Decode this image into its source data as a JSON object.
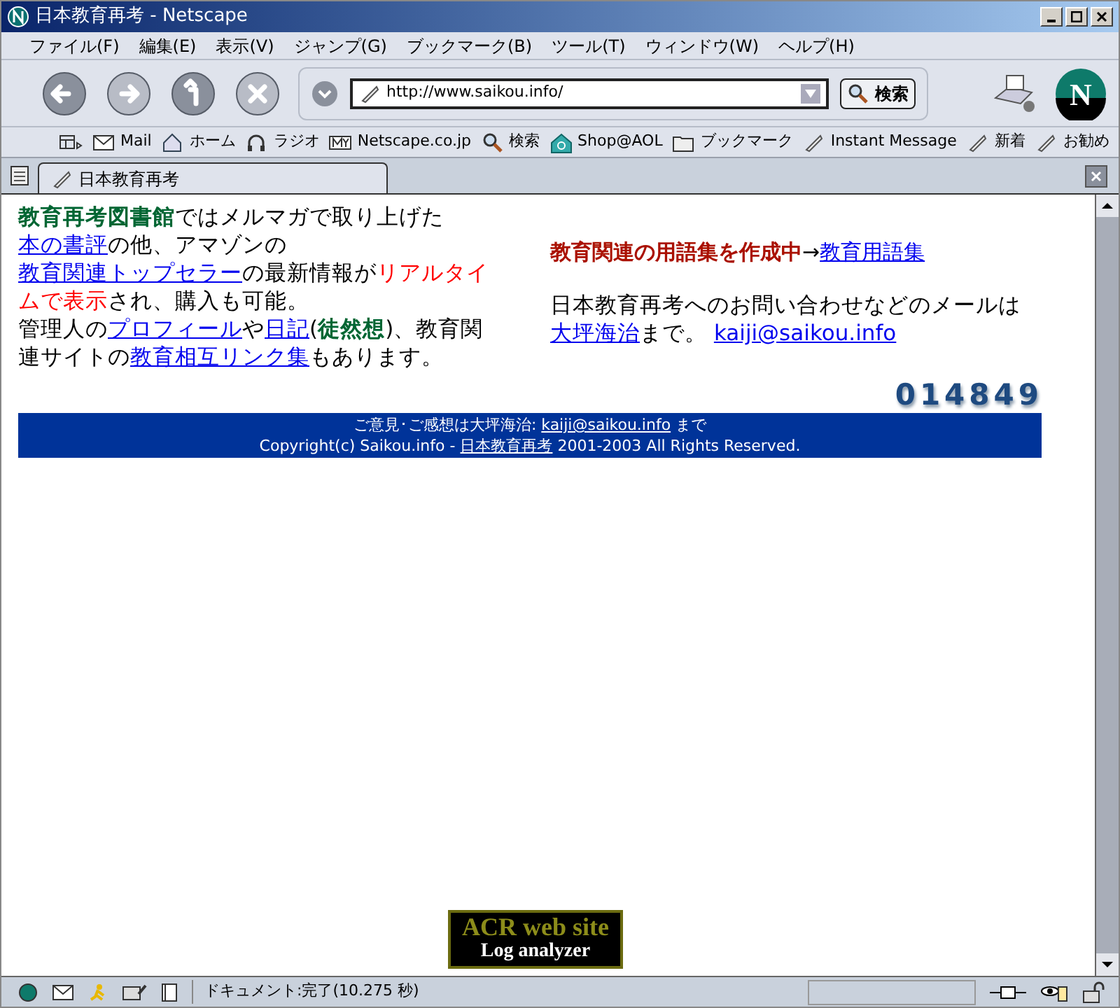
{
  "window": {
    "title": "日本教育再考 - Netscape"
  },
  "menu": [
    "ファイル(F)",
    "編集(E)",
    "表示(V)",
    "ジャンプ(G)",
    "ブックマーク(B)",
    "ツール(T)",
    "ウィンドウ(W)",
    "ヘルプ(H)"
  ],
  "address": {
    "value": "http://www.saikou.info/"
  },
  "search_button": "検索",
  "logo": "N",
  "personal_toolbar": [
    {
      "kind": "mail",
      "label": "Mail"
    },
    {
      "kind": "home",
      "label": "ホーム"
    },
    {
      "kind": "radio",
      "label": "ラジオ"
    },
    {
      "kind": "my",
      "label": "Netscape.co.jp"
    },
    {
      "kind": "search",
      "label": "検索"
    },
    {
      "kind": "shop",
      "label": "Shop@AOL"
    },
    {
      "kind": "folder",
      "label": "ブックマーク"
    },
    {
      "kind": "bookmark",
      "label": "Instant Message"
    },
    {
      "kind": "bookmark",
      "label": "新着"
    },
    {
      "kind": "bookmark",
      "label": "お勧め"
    }
  ],
  "tabs": [
    {
      "label": "日本教育再考",
      "selected": true
    }
  ],
  "left_paragraphs": [
    [
      {
        "kind": "bold_green",
        "text": "教育再考図書館"
      },
      {
        "kind": "plain",
        "text": "ではメルマガで取り上げた"
      },
      {
        "kind": "link",
        "text": "本の書評"
      },
      {
        "kind": "plain",
        "text": "の他、アマゾンの"
      },
      {
        "kind": "link",
        "text": "教育関連トップセラー"
      },
      {
        "kind": "plain",
        "text": "の最新情報が"
      },
      {
        "kind": "red",
        "text": "リアルタイムで表示"
      },
      {
        "kind": "plain",
        "text": "され、購入も可能。"
      }
    ],
    [
      {
        "kind": "plain",
        "text": "管理人の"
      },
      {
        "kind": "link",
        "text": "プロフィール"
      },
      {
        "kind": "plain",
        "text": "や"
      },
      {
        "kind": "link",
        "text": "日記"
      },
      {
        "kind": "plain",
        "text": "("
      },
      {
        "kind": "bold_green",
        "text": "徒然想"
      },
      {
        "kind": "plain",
        "text": ")、教育関連サイトの"
      },
      {
        "kind": "link",
        "text": "教育相互リンク集"
      },
      {
        "kind": "plain",
        "text": "もあります。"
      }
    ]
  ],
  "right_paragraphs": [
    [
      {
        "kind": "bold_red",
        "text": "教育関連の用語集を作成中"
      },
      {
        "kind": "plain",
        "text": "→"
      },
      {
        "kind": "link",
        "text": "教育用語集"
      }
    ],
    [
      {
        "kind": "plain",
        "text": "日本教育再考へのお問い合わせなどのメールは"
      },
      {
        "kind": "link",
        "text": "大坪海治"
      },
      {
        "kind": "plain",
        "text": "まで。 "
      },
      {
        "kind": "link",
        "text": "kaiji@saikou.info"
      }
    ]
  ],
  "counter": "014849",
  "footer": [
    [
      {
        "kind": "plain",
        "text": "ご意見･ご感想は大坪海治: "
      },
      {
        "kind": "link",
        "text": "kaiji@saikou.info"
      },
      {
        "kind": "plain",
        "text": " まで"
      }
    ],
    [
      {
        "kind": "plain",
        "text": "Copyright(c) Saikou.info - "
      },
      {
        "kind": "link",
        "text": "日本教育再考"
      },
      {
        "kind": "plain",
        "text": " 2001-2003 All Rights Reserved."
      }
    ]
  ],
  "banner": {
    "line_1": "ACR web site",
    "line_2": "Log analyzer"
  },
  "status_bar": {
    "text": "ドキュメント:完了(10.275 秒)"
  }
}
